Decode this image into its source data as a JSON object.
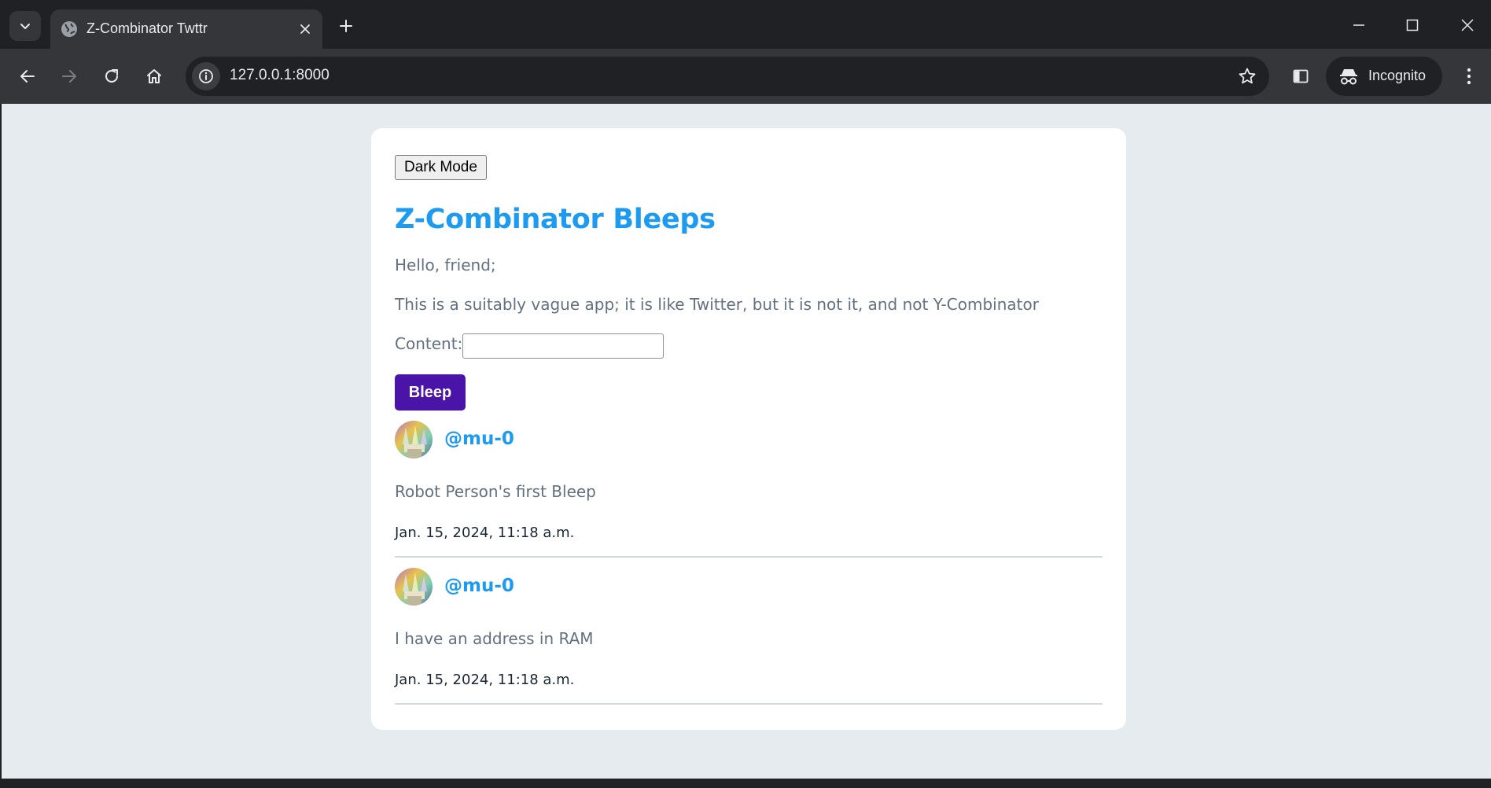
{
  "browser": {
    "tab_title": "Z-Combinator Twttr",
    "url": "127.0.0.1:8000",
    "profile_label": "Incognito"
  },
  "page": {
    "dark_mode_label": "Dark Mode",
    "title": "Z-Combinator Bleeps",
    "greeting": "Hello, friend;",
    "description": "This is a suitably vague app; it is like Twitter, but it is not it, and not Y-Combinator",
    "content_label": "Content:",
    "content_value": "",
    "submit_label": "Bleep"
  },
  "posts": [
    {
      "handle": "@mu-0",
      "body": "Robot Person's first Bleep",
      "timestamp": "Jan. 15, 2024, 11:18 a.m."
    },
    {
      "handle": "@mu-0",
      "body": "I have an address in RAM",
      "timestamp": "Jan. 15, 2024, 11:18 a.m."
    }
  ],
  "colors": {
    "accent": "#1d9bf0",
    "button_primary": "#4a14a8",
    "page_background": "#e6ebf0",
    "card_background": "#ffffff",
    "muted_text": "#627080"
  }
}
